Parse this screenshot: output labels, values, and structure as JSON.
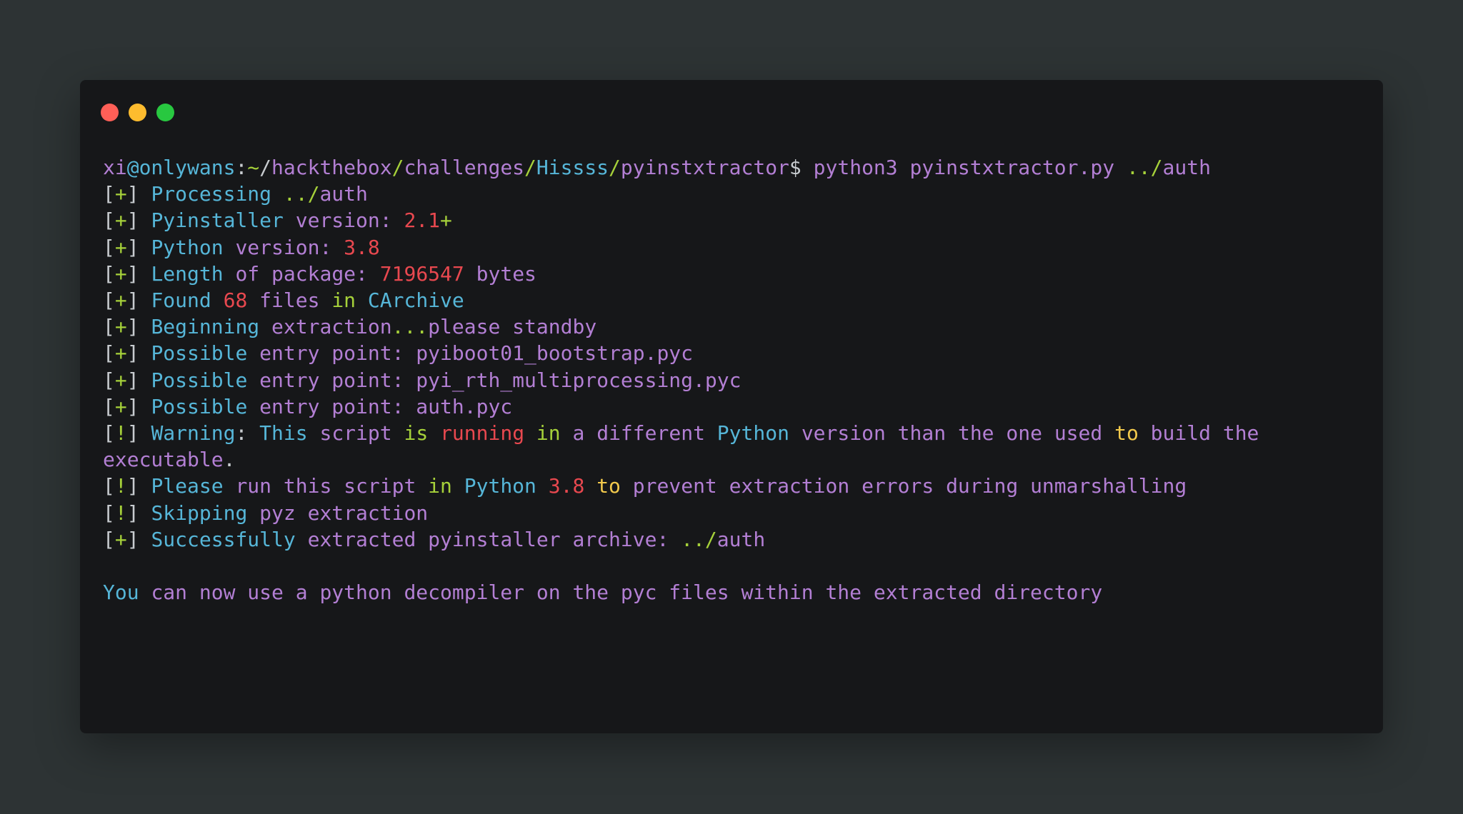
{
  "window": {
    "buttons": [
      {
        "name": "close",
        "color": "#ff5f57"
      },
      {
        "name": "minimize",
        "color": "#febc2e"
      },
      {
        "name": "maximize",
        "color": "#28c840"
      }
    ]
  },
  "colors": {
    "white": "#c8ccd0",
    "cyan": "#56b6d8",
    "purple": "#b37fd4",
    "green": "#a6d13a",
    "red": "#e8484f",
    "yellow": "#f2c94c",
    "gray": "#b9bfc4"
  },
  "terminal": {
    "lines": [
      [
        [
          "purple",
          "xi"
        ],
        [
          "cyan",
          "@onlywans"
        ],
        [
          "white",
          ":"
        ],
        [
          "green",
          "~"
        ],
        [
          "white",
          "/"
        ],
        [
          "purple",
          "hackthebox"
        ],
        [
          "green",
          "/"
        ],
        [
          "purple",
          "challenges"
        ],
        [
          "green",
          "/"
        ],
        [
          "cyan",
          "Hissss"
        ],
        [
          "green",
          "/"
        ],
        [
          "purple",
          "pyinstxtractor"
        ],
        [
          "white",
          "$ "
        ],
        [
          "purple",
          "python3 pyinstxtractor.py "
        ],
        [
          "green",
          "../"
        ],
        [
          "purple",
          "auth"
        ]
      ],
      [
        [
          "white",
          "["
        ],
        [
          "green",
          "+"
        ],
        [
          "white",
          "] "
        ],
        [
          "cyan",
          "Processing "
        ],
        [
          "green",
          "../"
        ],
        [
          "purple",
          "auth"
        ]
      ],
      [
        [
          "white",
          "["
        ],
        [
          "green",
          "+"
        ],
        [
          "white",
          "] "
        ],
        [
          "cyan",
          "Pyinstaller "
        ],
        [
          "purple",
          "version: "
        ],
        [
          "red",
          "2.1"
        ],
        [
          "green",
          "+"
        ]
      ],
      [
        [
          "white",
          "["
        ],
        [
          "green",
          "+"
        ],
        [
          "white",
          "] "
        ],
        [
          "cyan",
          "Python "
        ],
        [
          "purple",
          "version: "
        ],
        [
          "red",
          "3.8"
        ]
      ],
      [
        [
          "white",
          "["
        ],
        [
          "green",
          "+"
        ],
        [
          "white",
          "] "
        ],
        [
          "cyan",
          "Length "
        ],
        [
          "purple",
          "of package: "
        ],
        [
          "red",
          "7196547"
        ],
        [
          "purple",
          " bytes"
        ]
      ],
      [
        [
          "white",
          "["
        ],
        [
          "green",
          "+"
        ],
        [
          "white",
          "] "
        ],
        [
          "cyan",
          "Found "
        ],
        [
          "red",
          "68"
        ],
        [
          "purple",
          " files "
        ],
        [
          "green",
          "in"
        ],
        [
          "cyan",
          " CArchive"
        ]
      ],
      [
        [
          "white",
          "["
        ],
        [
          "green",
          "+"
        ],
        [
          "white",
          "] "
        ],
        [
          "cyan",
          "Beginning "
        ],
        [
          "purple",
          "extraction"
        ],
        [
          "green",
          "..."
        ],
        [
          "purple",
          "please standby"
        ]
      ],
      [
        [
          "white",
          "["
        ],
        [
          "green",
          "+"
        ],
        [
          "white",
          "] "
        ],
        [
          "cyan",
          "Possible "
        ],
        [
          "purple",
          "entry point: pyiboot01_bootstrap.pyc"
        ]
      ],
      [
        [
          "white",
          "["
        ],
        [
          "green",
          "+"
        ],
        [
          "white",
          "] "
        ],
        [
          "cyan",
          "Possible "
        ],
        [
          "purple",
          "entry point: pyi_rth_multiprocessing.pyc"
        ]
      ],
      [
        [
          "white",
          "["
        ],
        [
          "green",
          "+"
        ],
        [
          "white",
          "] "
        ],
        [
          "cyan",
          "Possible "
        ],
        [
          "purple",
          "entry point: auth.pyc"
        ]
      ],
      [
        [
          "white",
          "["
        ],
        [
          "green",
          "!"
        ],
        [
          "white",
          "] "
        ],
        [
          "cyan",
          "Warning"
        ],
        [
          "white",
          ": "
        ],
        [
          "cyan",
          "This "
        ],
        [
          "purple",
          "script "
        ],
        [
          "green",
          "is "
        ],
        [
          "red",
          "running "
        ],
        [
          "green",
          "in "
        ],
        [
          "purple",
          "a different "
        ],
        [
          "cyan",
          "Python "
        ],
        [
          "purple",
          "version than the one used "
        ],
        [
          "yellow",
          "to"
        ],
        [
          "purple",
          " build the"
        ]
      ],
      [
        [
          "purple",
          "executable"
        ],
        [
          "white",
          "."
        ]
      ],
      [
        [
          "white",
          "["
        ],
        [
          "green",
          "!"
        ],
        [
          "white",
          "] "
        ],
        [
          "cyan",
          "Please "
        ],
        [
          "purple",
          "run this script "
        ],
        [
          "green",
          "in "
        ],
        [
          "cyan",
          "Python "
        ],
        [
          "red",
          "3.8"
        ],
        [
          "yellow",
          " to"
        ],
        [
          "purple",
          " prevent extraction errors during unmarshalling"
        ]
      ],
      [
        [
          "white",
          "["
        ],
        [
          "green",
          "!"
        ],
        [
          "white",
          "] "
        ],
        [
          "cyan",
          "Skipping "
        ],
        [
          "purple",
          "pyz extraction"
        ]
      ],
      [
        [
          "white",
          "["
        ],
        [
          "green",
          "+"
        ],
        [
          "white",
          "] "
        ],
        [
          "cyan",
          "Successfully "
        ],
        [
          "purple",
          "extracted pyinstaller archive: "
        ],
        [
          "green",
          "../"
        ],
        [
          "purple",
          "auth"
        ]
      ],
      [],
      [
        [
          "cyan",
          "You "
        ],
        [
          "purple",
          "can now use a python decompiler on the pyc files within the extracted directory"
        ]
      ]
    ]
  }
}
